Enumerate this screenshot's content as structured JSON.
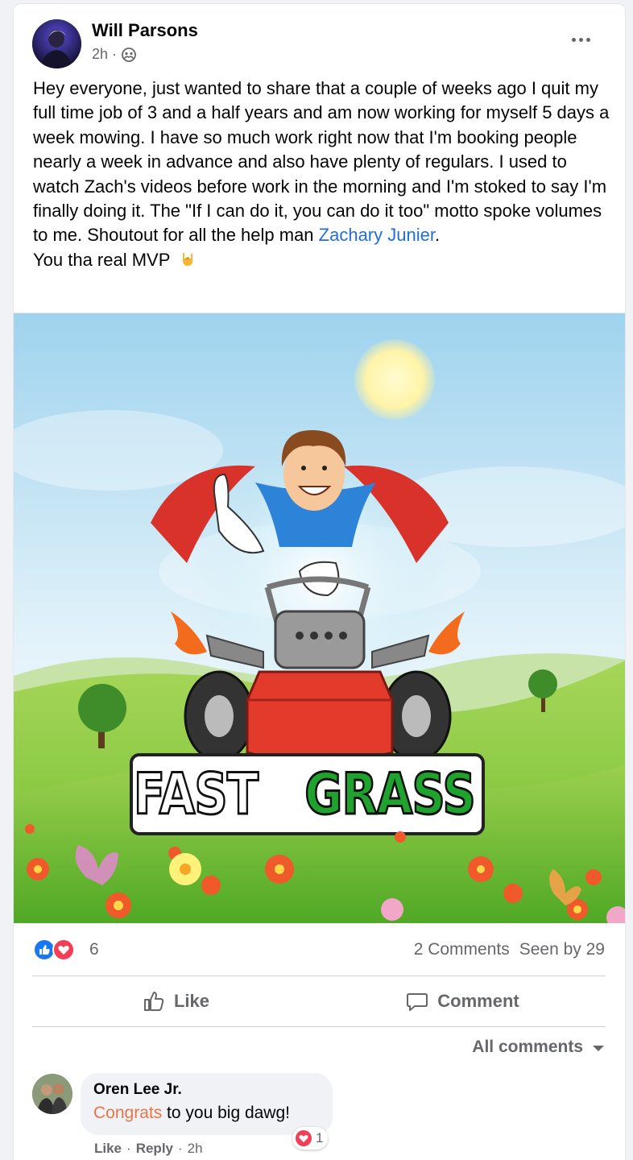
{
  "post": {
    "author": "Will Parsons",
    "time": "2h",
    "separator": "·",
    "privacy_icon": "group-icon",
    "body_main": "Hey everyone, just wanted to share that a couple of weeks ago I quit my full time job of 3 and a half years and am now working for myself 5 days a week mowing. I have so much work right now that I'm booking people nearly a week in advance and also have plenty of regulars. I used to watch Zach's videos before work in the morning and I'm stoked to say I'm finally doing it. The \"If I can do it, you can do it too\" motto spoke volumes to me. Shoutout for all the help man ",
    "mention": "Zachary Junier",
    "mention_suffix": ".",
    "body_line2": "You tha real MVP",
    "emoji_icon": "rock-on-hand-icon",
    "image_logo": {
      "word1": "FAST",
      "word2": "GRASS"
    }
  },
  "stats": {
    "reaction_icons": [
      "like-icon",
      "love-icon"
    ],
    "reaction_count": "6",
    "comments": "2 Comments",
    "seen_by": "Seen by 29"
  },
  "actions": {
    "like_label": "Like",
    "comment_label": "Comment"
  },
  "comments_filter": {
    "label": "All comments"
  },
  "comment": {
    "author": "Oren Lee Jr.",
    "highlight": "Congrats",
    "text_rest": " to you big dawg!",
    "like": "Like",
    "reply": "Reply",
    "separator": "·",
    "time": "2h",
    "reaction_count": "1"
  },
  "colors": {
    "link": "#216fdb",
    "muted": "#65676b",
    "like_blue": "#1877f2",
    "love_red": "#f33e58",
    "grass_green": "#1fa32e",
    "highlight_orange": "#e8744a"
  }
}
